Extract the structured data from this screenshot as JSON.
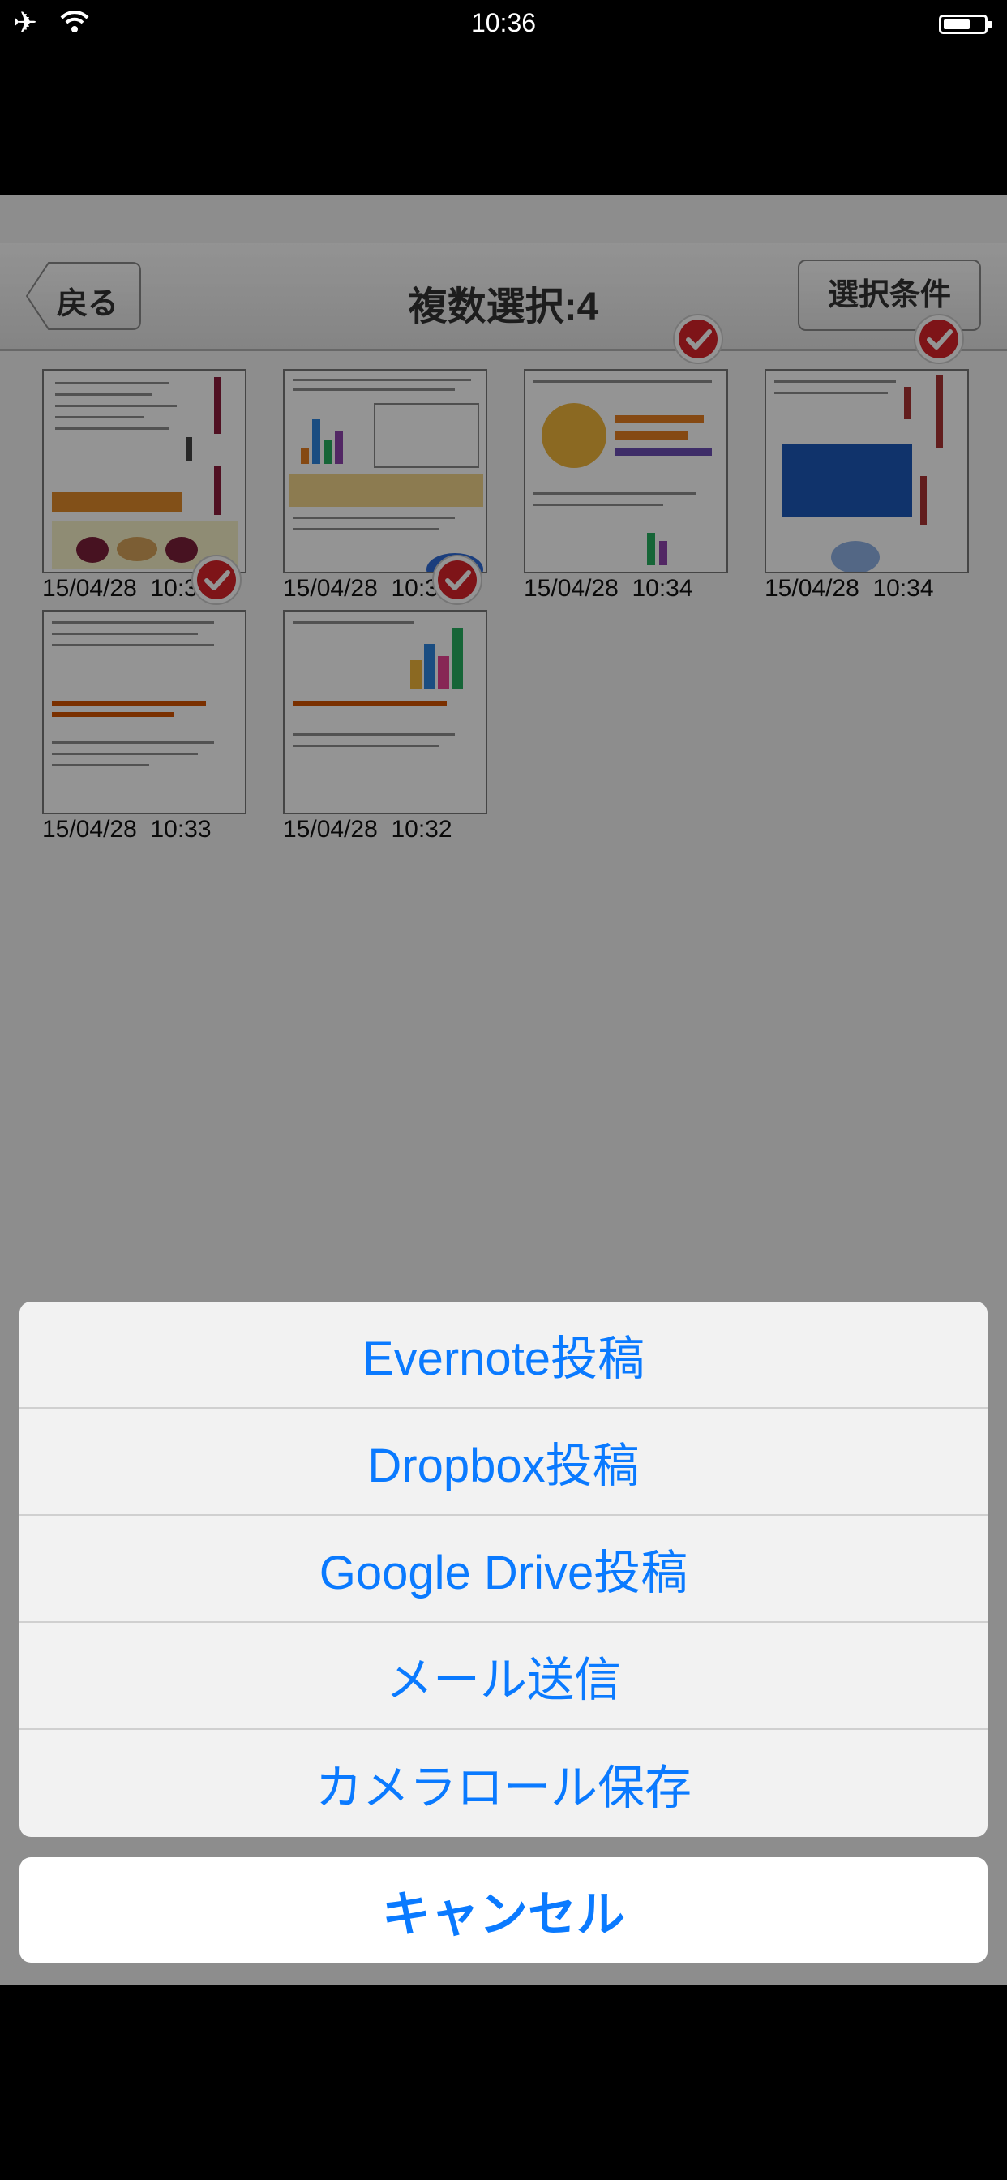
{
  "status": {
    "time": "10:36"
  },
  "nav": {
    "back_label": "戻る",
    "title": "複数選択:4",
    "condition_label": "選択条件"
  },
  "photos": [
    {
      "date": "15/04/28",
      "time": "10:35",
      "selected": false
    },
    {
      "date": "15/04/28",
      "time": "10:34",
      "selected": false
    },
    {
      "date": "15/04/28",
      "time": "10:34",
      "selected": true
    },
    {
      "date": "15/04/28",
      "time": "10:34",
      "selected": true
    },
    {
      "date": "15/04/28",
      "time": "10:33",
      "selected": true
    },
    {
      "date": "15/04/28",
      "time": "10:32",
      "selected": true
    }
  ],
  "action_sheet": {
    "options": [
      "Evernote投稿",
      "Dropbox投稿",
      "Google Drive投稿",
      "メール送信",
      "カメラロール保存"
    ],
    "cancel": "キャンセル"
  },
  "colors": {
    "accent": "#0a7aff",
    "check": "#d9232a"
  },
  "icons": [
    "airplane-icon",
    "wifi-icon",
    "battery-icon",
    "checkmark-icon"
  ]
}
